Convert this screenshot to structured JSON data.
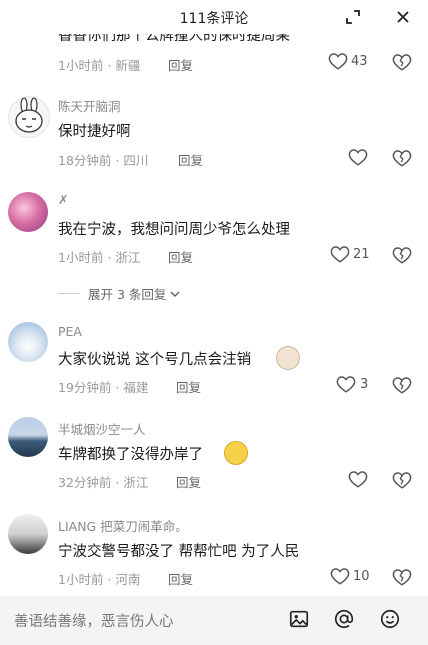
{
  "header": {
    "title": "111条评论",
    "expand_icon": "expand-icon",
    "close_icon": "close-icon"
  },
  "partial_comment": {
    "text": "香香你们那个公牌撞人的保时捷周某",
    "meta": "1小时前 · 新疆",
    "reply": "回复",
    "likes": "43"
  },
  "comments": [
    {
      "username": "陈天开脑洞",
      "text": "保时捷好啊",
      "meta": "18分钟前 · 四川",
      "reply": "回复",
      "likes": ""
    },
    {
      "username": "✗",
      "text": "我在宁波，我想问问周少爷怎么处理",
      "meta": "1小时前 · 浙江",
      "reply": "回复",
      "likes": "21"
    },
    {
      "username": "PEA",
      "text": "大家伙说说 这个号几点会注销",
      "meta": "19分钟前 · 福建",
      "reply": "回复",
      "likes": "3"
    },
    {
      "username": "半城烟沙空一人",
      "text": "车牌都换了没得办岸了",
      "meta": "32分钟前 · 浙江",
      "reply": "回复",
      "likes": ""
    },
    {
      "username": "LIANG 把菜刀闹革命。",
      "text": "宁波交警号都没了  帮帮忙吧  为了人民",
      "meta": "1小时前 · 河南",
      "reply": "回复",
      "likes": "10"
    }
  ],
  "expand_replies": "展开 3 条回复",
  "input": {
    "placeholder": "善语结善缘，恶言伤人心",
    "icons": [
      "image-icon",
      "at-icon",
      "emoji-icon"
    ]
  },
  "colors": {
    "like_outline": "#555555",
    "meta_text": "#9a9a9a",
    "username": "#8a8a8a"
  }
}
